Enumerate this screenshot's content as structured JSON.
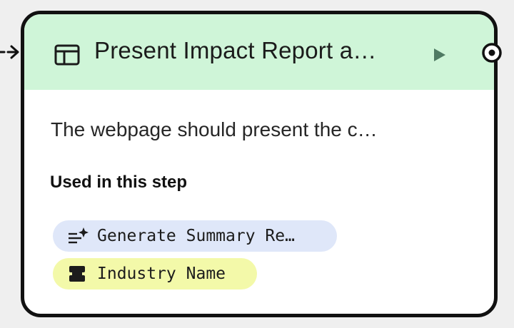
{
  "node": {
    "title": "Present Impact Report a…",
    "description": "The webpage should present the c…",
    "used_in_step_heading": "Used in this step",
    "header_icon": "web-layout-icon",
    "run_icon": "play-icon"
  },
  "chips": [
    {
      "label": "Generate Summary Re…",
      "icon": "text-sparkle-icon",
      "color": "#dfe7f9"
    },
    {
      "label": "Industry Name",
      "icon": "input-bars-icon",
      "color": "#f3f9a9"
    }
  ],
  "colors": {
    "header_background": "#cff5d8",
    "card_border": "#111111",
    "run_icon": "#4f7a63"
  }
}
